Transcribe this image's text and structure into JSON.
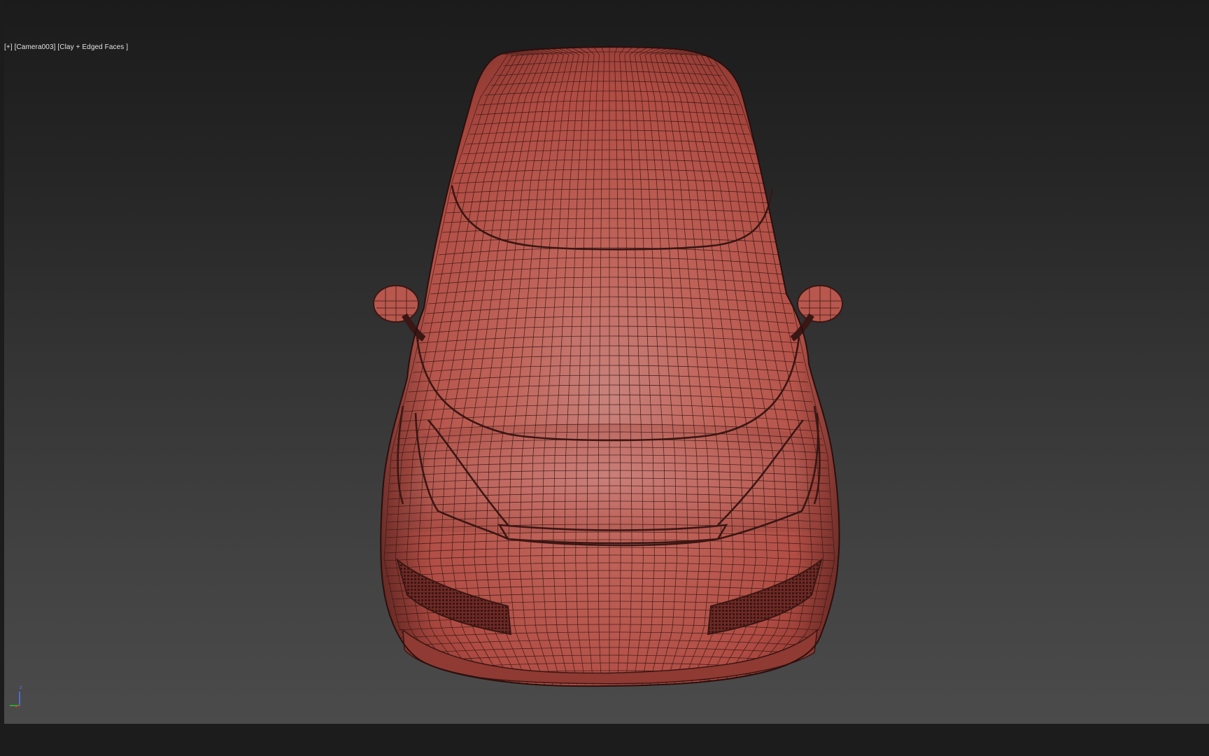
{
  "viewport": {
    "label": {
      "plus": "[+]",
      "camera": "[Camera003]",
      "shading": "[Clay + Edged Faces ]"
    },
    "shading_color": "#c05a4e",
    "wire_color": "#3a1714",
    "background_top": "#1b1b1b",
    "background_bottom": "#4b4b4b"
  },
  "axis": {
    "z_label": "z",
    "x_color": "#27c427",
    "y_color": "#27c427",
    "z_color": "#4f78ff"
  }
}
